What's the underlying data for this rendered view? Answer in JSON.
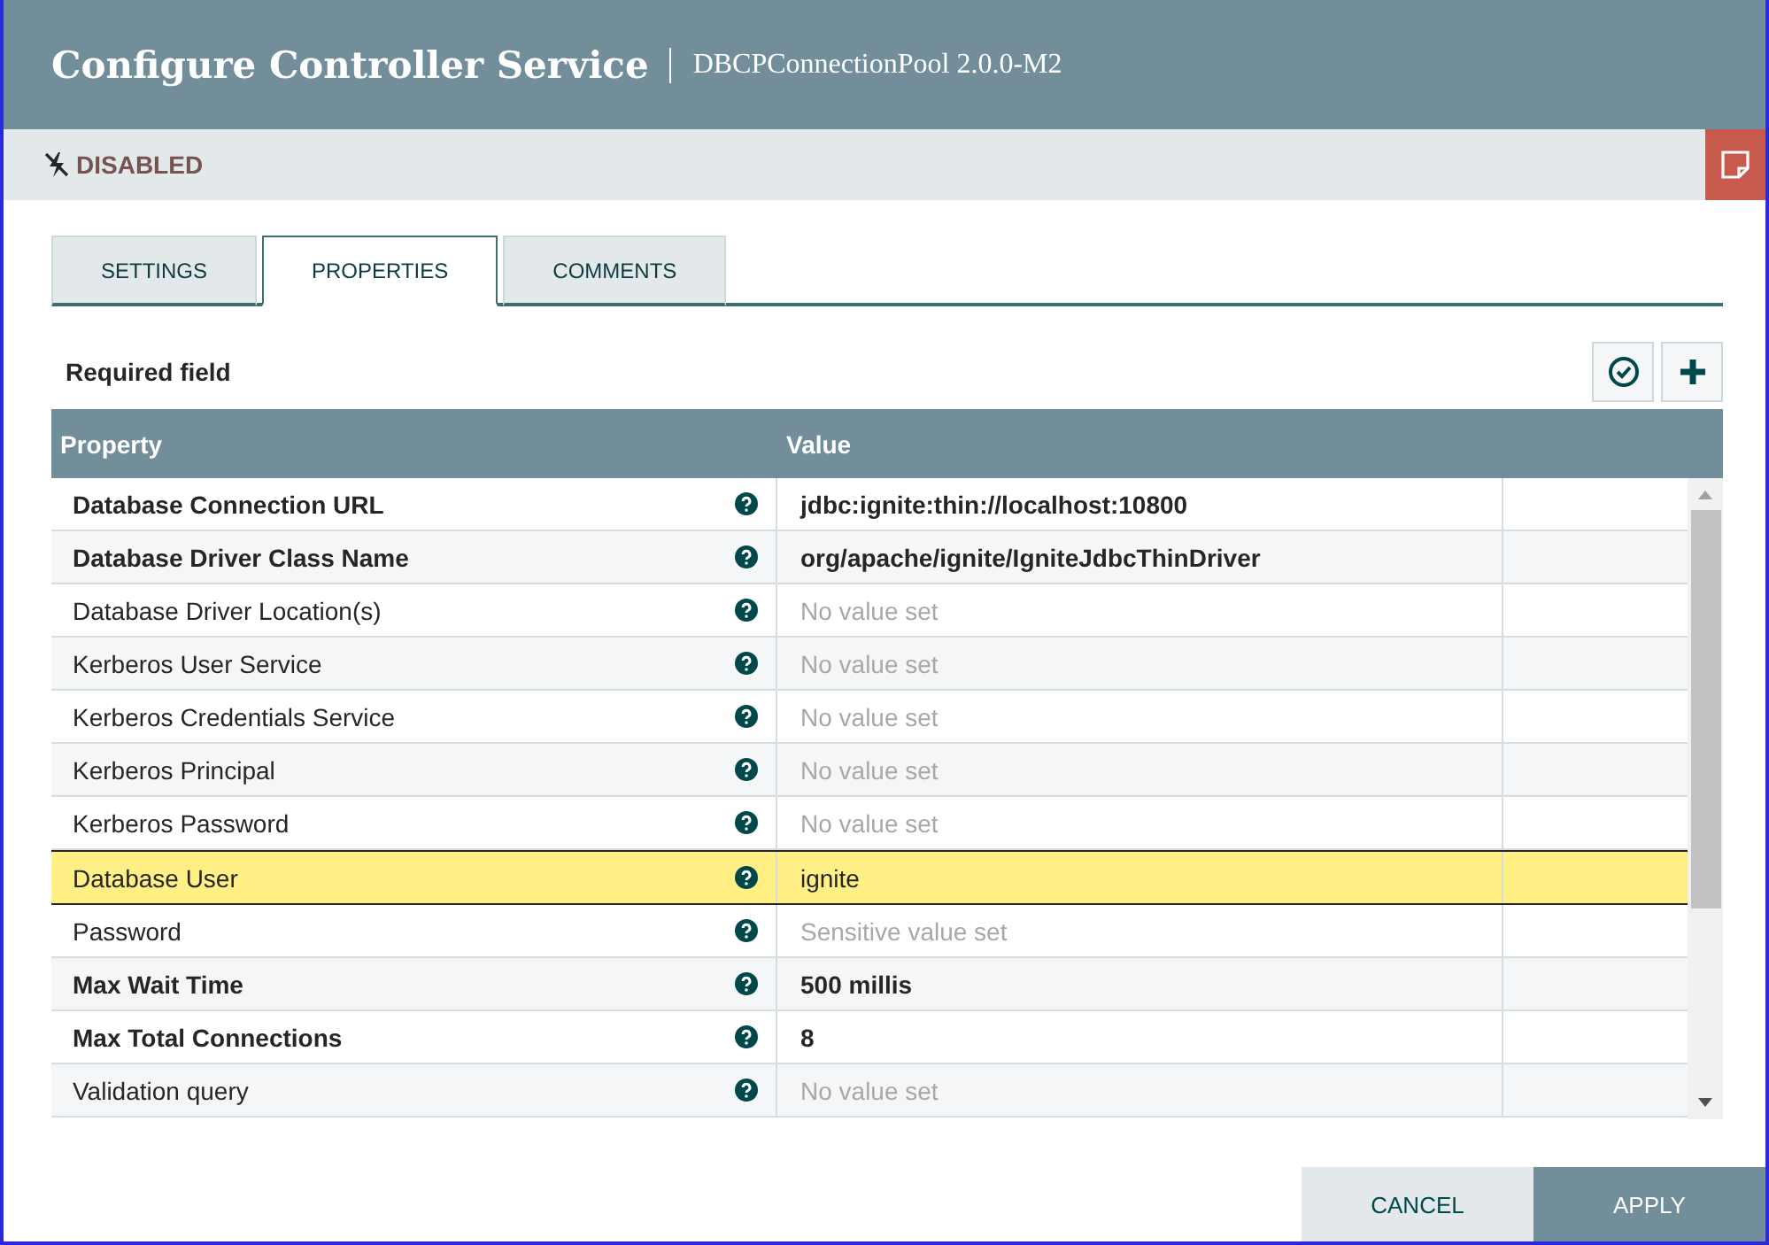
{
  "header": {
    "title": "Configure Controller Service",
    "subtitle": "DBCPConnectionPool 2.0.0-M2"
  },
  "status": {
    "label": "DISABLED"
  },
  "tabs": [
    {
      "label": "SETTINGS",
      "selected": false
    },
    {
      "label": "PROPERTIES",
      "selected": true
    },
    {
      "label": "COMMENTS",
      "selected": false
    }
  ],
  "required_note": "Required field",
  "table": {
    "columns": [
      "Property",
      "Value"
    ],
    "rows": [
      {
        "property": "Database Connection URL",
        "required": true,
        "value": "jdbc:ignite:thin://localhost:10800",
        "value_set": true,
        "selected": false
      },
      {
        "property": "Database Driver Class Name",
        "required": true,
        "value": "org/apache/ignite/IgniteJdbcThinDriver",
        "value_set": true,
        "selected": false
      },
      {
        "property": "Database Driver Location(s)",
        "required": false,
        "value": "No value set",
        "value_set": false,
        "selected": false
      },
      {
        "property": "Kerberos User Service",
        "required": false,
        "value": "No value set",
        "value_set": false,
        "selected": false
      },
      {
        "property": "Kerberos Credentials Service",
        "required": false,
        "value": "No value set",
        "value_set": false,
        "selected": false
      },
      {
        "property": "Kerberos Principal",
        "required": false,
        "value": "No value set",
        "value_set": false,
        "selected": false
      },
      {
        "property": "Kerberos Password",
        "required": false,
        "value": "No value set",
        "value_set": false,
        "selected": false
      },
      {
        "property": "Database User",
        "required": false,
        "value": "ignite",
        "value_set": true,
        "selected": true
      },
      {
        "property": "Password",
        "required": false,
        "value": "Sensitive value set",
        "value_set": false,
        "selected": false
      },
      {
        "property": "Max Wait Time",
        "required": true,
        "value": "500 millis",
        "value_set": true,
        "selected": false
      },
      {
        "property": "Max Total Connections",
        "required": true,
        "value": "8",
        "value_set": true,
        "selected": false
      },
      {
        "property": "Validation query",
        "required": false,
        "value": "No value set",
        "value_set": false,
        "selected": false
      }
    ]
  },
  "buttons": [
    {
      "label": "CANCEL",
      "kind": "secondary"
    },
    {
      "label": "APPLY",
      "kind": "primary"
    }
  ]
}
